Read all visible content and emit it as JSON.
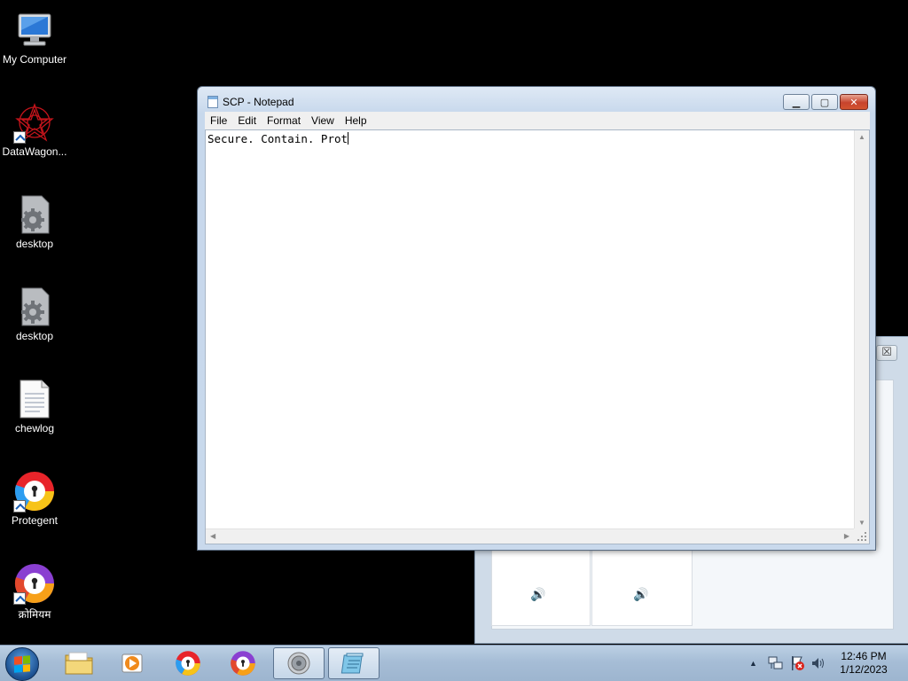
{
  "desktop": {
    "icons": [
      {
        "label": "My Computer",
        "icon": "computer-icon"
      },
      {
        "label": "DataWagon...",
        "icon": "datawagon-icon"
      },
      {
        "label": "desktop",
        "icon": "gear-file-icon"
      },
      {
        "label": "desktop",
        "icon": "gear-file-icon"
      },
      {
        "label": "chewlog",
        "icon": "text-file-icon"
      },
      {
        "label": "Protegent",
        "icon": "protegent-icon"
      },
      {
        "label": "क्रोमियम",
        "icon": "protegent-purple-icon"
      }
    ]
  },
  "notepad": {
    "title": "SCP - Notepad",
    "menu": [
      "File",
      "Edit",
      "Format",
      "View",
      "Help"
    ],
    "content": "Secure. Contain. Prot",
    "buttons": {
      "minimize": "▁",
      "maximize": "▢",
      "close": "✕"
    }
  },
  "background_window": {
    "close_symbol": "☒"
  },
  "taskbar": {
    "pinned": [
      "folder-icon",
      "media-player-icon",
      "protegent-icon",
      "protegent-purple-icon",
      "speaker-app-icon",
      "notepad-icon"
    ],
    "tray": {
      "expand": "▲",
      "network": "network-icon",
      "flag": "action-center-icon",
      "volume": "volume-icon"
    },
    "time": "12:46 PM",
    "date": "1/12/2023"
  },
  "colors": {
    "accent": "#1a5fb4",
    "close_red": "#c7432d",
    "taskbar": "#a6bdd6"
  }
}
